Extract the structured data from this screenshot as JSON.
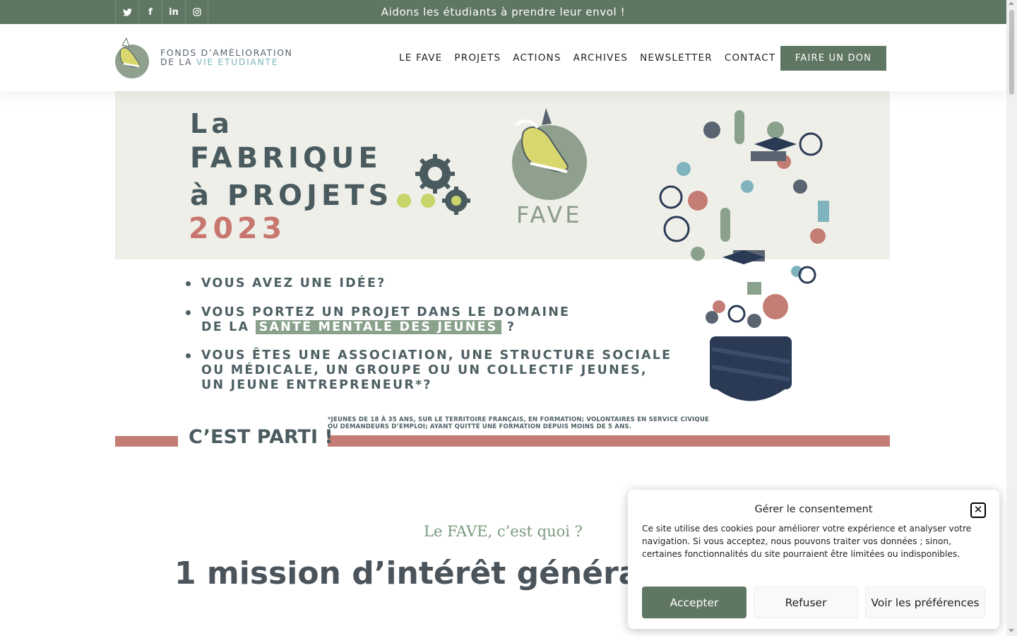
{
  "topbar": {
    "tagline": "Aidons les étudiants à prendre leur envol !",
    "social": [
      {
        "icon": "twitter-icon",
        "glyph": "🐦"
      },
      {
        "icon": "facebook-icon",
        "glyph": "f"
      },
      {
        "icon": "linkedin-icon",
        "glyph": "in"
      },
      {
        "icon": "instagram-icon",
        "glyph": "◎"
      }
    ]
  },
  "header": {
    "logo_line1": "FONDS D’AMÉLIORATION",
    "logo_line2_a": "DE LA ",
    "logo_line2_b": "VIE ETUDIANTE",
    "nav": [
      "LE FAVE",
      "PROJETS",
      "ACTIONS",
      "ARCHIVES",
      "NEWSLETTER",
      "CONTACT"
    ],
    "cta": "FAIRE UN DON"
  },
  "banner": {
    "line_la": "La",
    "line_fabrique": "FABRIQUE",
    "line_projets": "à PROJETS",
    "year": "2023",
    "fave": "FAVE",
    "bullet1": "VOUS AVEZ UNE IDÉE?",
    "bullet2_a": "VOUS PORTEZ UN PROJET DANS LE DOMAINE",
    "bullet2_b": "DE LA ",
    "bullet2_hl": "SANTÉ MENTALE DES JEUNES",
    "bullet2_c": " ?",
    "bullet3_a": "VOUS ÊTES UNE ASSOCIATION, UNE STRUCTURE SOCIALE",
    "bullet3_b": "OU MÉDICALE, UN GROUPE OU UN COLLECTIF JEUNES,",
    "bullet3_c": "UN JEUNE ENTREPRENEUR*?",
    "footnote_1": "*JEUNES DE 18 À 35 ANS, SUR LE TERRITOIRE FRANÇAIS, EN FORMATION; VOLONTAIRES EN SERVICE CIVIQUE",
    "footnote_2": "OU DEMANDEURS D’EMPLOI; AYANT QUITTÉ UNE FORMATION DEPUIS MOINS DE 5 ANS.",
    "parti": "C’EST PARTI !"
  },
  "section": {
    "subtitle": "Le FAVE, c’est quoi ?",
    "title": "1 mission d’intérêt général"
  },
  "consent": {
    "title": "Gérer le consentement",
    "body": "Ce site utilise des cookies pour améliorer votre expérience et analyser votre navigation. Si vous acceptez, nous pouvons traiter vos données ; sinon, certaines fonctionnalités du site pourraient être limitées ou indisponibles.",
    "accept": "Accepter",
    "refuse": "Refuser",
    "prefs": "Voir les préférences"
  },
  "colors": {
    "brand_green": "#5f7663",
    "rose": "#c47d74",
    "slate": "#4a5b5f",
    "sage": "#8aa18c"
  }
}
